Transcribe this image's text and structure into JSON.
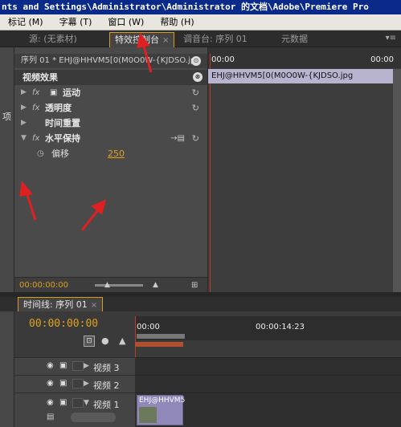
{
  "window": {
    "title": "nts and Settings\\Administrator\\Administrator 的文档\\Adobe\\Premiere Pro"
  },
  "menu": {
    "items": [
      "标记 (M)",
      "字幕 (T)",
      "窗口 (W)",
      "帮助 (H)"
    ]
  },
  "tabs": {
    "source": "源: (无素材)",
    "effect_controls": "特效控制台",
    "audio_mixer": "调音台: 序列 01",
    "metadata": "元数据",
    "close_glyph": "×"
  },
  "left_sliver": {
    "label": "项"
  },
  "effect_controls": {
    "clip_path": "序列 01 * EHJ@HHVM5[0(M0O0W-{KJDSO.jpg",
    "video_effects_label": "视频效果",
    "effects": [
      {
        "fx": "fx",
        "label": "运动",
        "icon": "motion-icon"
      },
      {
        "fx": "fx",
        "label": "透明度"
      },
      {
        "fx": "",
        "label": "时间重置"
      },
      {
        "fx": "fx",
        "label": "水平保持",
        "expanded": true
      }
    ],
    "param": {
      "label": "偏移",
      "value": "250"
    },
    "footer_timecode": "00:00:00:00"
  },
  "ec_timeline": {
    "ruler_start": "00:00",
    "ruler_end": "00:00",
    "clip_name": "EHJ@HHVM5[0(M0O0W-{KJDSO.jpg"
  },
  "timeline": {
    "tab_label": "时间线: 序列 01",
    "timecode": "00:00:00:00",
    "ruler_start": "00:00",
    "ruler_mark": "00:00:14:23",
    "tracks": [
      {
        "name": "视频 3"
      },
      {
        "name": "视频 2"
      },
      {
        "name": "视频 1"
      }
    ],
    "clip_label": "EHJ@HHVM5"
  },
  "colors": {
    "accent": "#d89a20",
    "playhead": "#c0392b",
    "annotation_arrow": "#e02020",
    "clip": "#b8b4cf"
  }
}
